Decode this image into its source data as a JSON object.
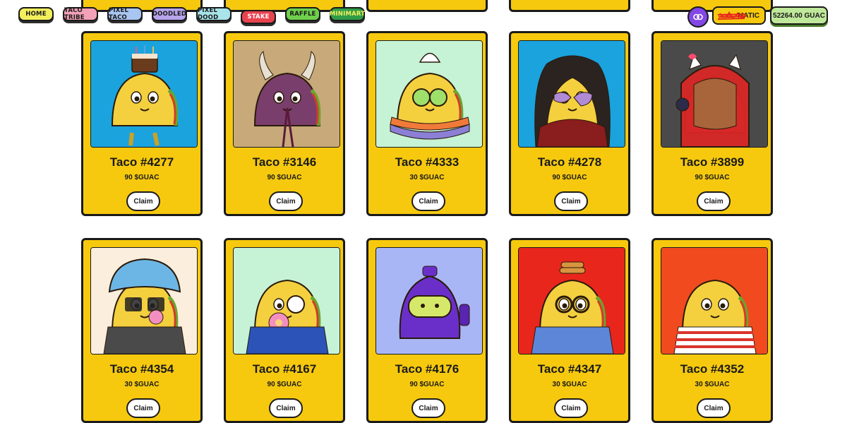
{
  "nav": {
    "items": [
      {
        "label": "HOME",
        "bg": "#f3ef5c"
      },
      {
        "label": "TACO TRIBE",
        "bg": "#f3a1b8"
      },
      {
        "label": "PIXEL TACO",
        "bg": "#a9c6f2"
      },
      {
        "label": "DOODLED",
        "bg": "#b8a4ec"
      },
      {
        "label": "PIXEL DOOD",
        "bg": "#a9e4ea"
      },
      {
        "label": "STAKE",
        "bg": "#e9424f"
      },
      {
        "label": "RAFFLE",
        "bg": "#6fd14b"
      },
      {
        "label": "MINIMART",
        "bg": "#2f9d47"
      }
    ],
    "matic_label": "MATIC",
    "guac_balance": "52264.00 GUAC"
  },
  "cards": [
    {
      "title": "Taco #4277",
      "price": "90 $GUAC",
      "claim": "Claim",
      "art_bg": "#1aa3dd",
      "art": "cake"
    },
    {
      "title": "Taco #3146",
      "price": "90 $GUAC",
      "claim": "Claim",
      "art_bg": "#c7a97a",
      "art": "devil"
    },
    {
      "title": "Taco #4333",
      "price": "30 $GUAC",
      "claim": "Claim",
      "art_bg": "#c6f2d6",
      "art": "sundae"
    },
    {
      "title": "Taco #4278",
      "price": "90 $GUAC",
      "claim": "Claim",
      "art_bg": "#1aa3dd",
      "art": "hair"
    },
    {
      "title": "Taco #3899",
      "price": "90 $GUAC",
      "claim": "Claim",
      "art_bg": "#4a4a4a",
      "art": "hoodie"
    },
    {
      "title": "Taco #4354",
      "price": "30 $GUAC",
      "claim": "Claim",
      "art_bg": "#fbeedd",
      "art": "showercap"
    },
    {
      "title": "Taco #4167",
      "price": "90 $GUAC",
      "claim": "Claim",
      "art_bg": "#c6f2d6",
      "art": "donut"
    },
    {
      "title": "Taco #4176",
      "price": "90 $GUAC",
      "claim": "Claim",
      "art_bg": "#a9b6f5",
      "art": "robot"
    },
    {
      "title": "Taco #4347",
      "price": "30 $GUAC",
      "claim": "Claim",
      "art_bg": "#e8261c",
      "art": "pancake"
    },
    {
      "title": "Taco #4352",
      "price": "30 $GUAC",
      "claim": "Claim",
      "art_bg": "#f04a1e",
      "art": "stripes"
    }
  ]
}
